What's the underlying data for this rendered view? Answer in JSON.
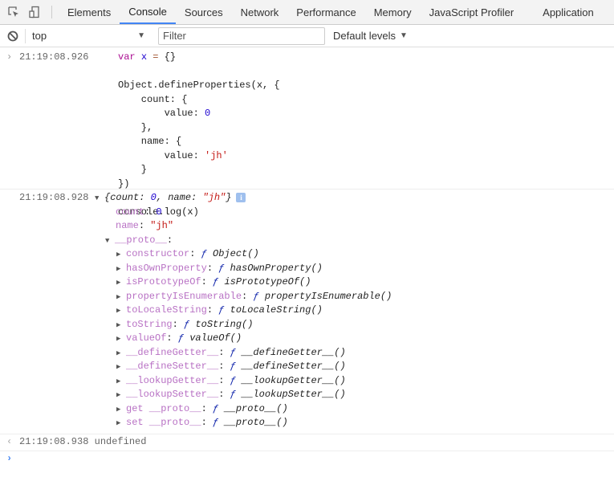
{
  "tabs": [
    "Elements",
    "Console",
    "Sources",
    "Network",
    "Performance",
    "Memory",
    "JavaScript Profiler",
    "Application"
  ],
  "active_tab": "Console",
  "toolbar": {
    "context": "top",
    "filter_placeholder": "Filter",
    "levels": "Default levels"
  },
  "input_message": {
    "timestamp": "21:19:08.926",
    "code_lines": [
      [
        [
          "kw",
          "var "
        ],
        [
          "var",
          "x"
        ],
        [
          "op",
          " = "
        ],
        [
          "pl",
          "{}"
        ]
      ],
      [],
      [
        [
          "pl",
          "Object.defineProperties(x, {"
        ]
      ],
      [
        [
          "pl",
          "    count: {"
        ]
      ],
      [
        [
          "pl",
          "        value: "
        ],
        [
          "num",
          "0"
        ]
      ],
      [
        [
          "pl",
          "    },"
        ]
      ],
      [
        [
          "pl",
          "    name: {"
        ]
      ],
      [
        [
          "pl",
          "        value: "
        ],
        [
          "str",
          "'jh'"
        ]
      ],
      [
        [
          "pl",
          "    }"
        ]
      ],
      [
        [
          "pl",
          "})"
        ]
      ],
      [],
      [
        [
          "pl",
          "console.log(x)"
        ]
      ]
    ]
  },
  "log_message": {
    "timestamp": "21:19:08.928",
    "summary": {
      "open": "{",
      "k1": "count",
      "v1": "0",
      "k2": "name",
      "v2": "\"jh\"",
      "close": "}"
    },
    "props": [
      {
        "key": "count",
        "value": "0",
        "type": "num"
      },
      {
        "key": "name",
        "value": "\"jh\"",
        "type": "str"
      }
    ],
    "proto_label": "__proto__",
    "proto_items": [
      {
        "key": "constructor",
        "fn": "Object()"
      },
      {
        "key": "hasOwnProperty",
        "fn": "hasOwnProperty()"
      },
      {
        "key": "isPrototypeOf",
        "fn": "isPrototypeOf()"
      },
      {
        "key": "propertyIsEnumerable",
        "fn": "propertyIsEnumerable()"
      },
      {
        "key": "toLocaleString",
        "fn": "toLocaleString()"
      },
      {
        "key": "toString",
        "fn": "toString()"
      },
      {
        "key": "valueOf",
        "fn": "valueOf()"
      },
      {
        "key": "__defineGetter__",
        "fn": "__defineGetter__()"
      },
      {
        "key": "__defineSetter__",
        "fn": "__defineSetter__()"
      },
      {
        "key": "__lookupGetter__",
        "fn": "__lookupGetter__()"
      },
      {
        "key": "__lookupSetter__",
        "fn": "__lookupSetter__()"
      },
      {
        "key": "get __proto__",
        "fn": "__proto__()"
      },
      {
        "key": "set __proto__",
        "fn": "__proto__()"
      }
    ]
  },
  "result_message": {
    "timestamp": "21:19:08.938",
    "value": "undefined"
  },
  "colors": {
    "accent": "#4285f4",
    "property": "#b871c4",
    "string": "#c41a16",
    "number": "#1c00cf"
  }
}
